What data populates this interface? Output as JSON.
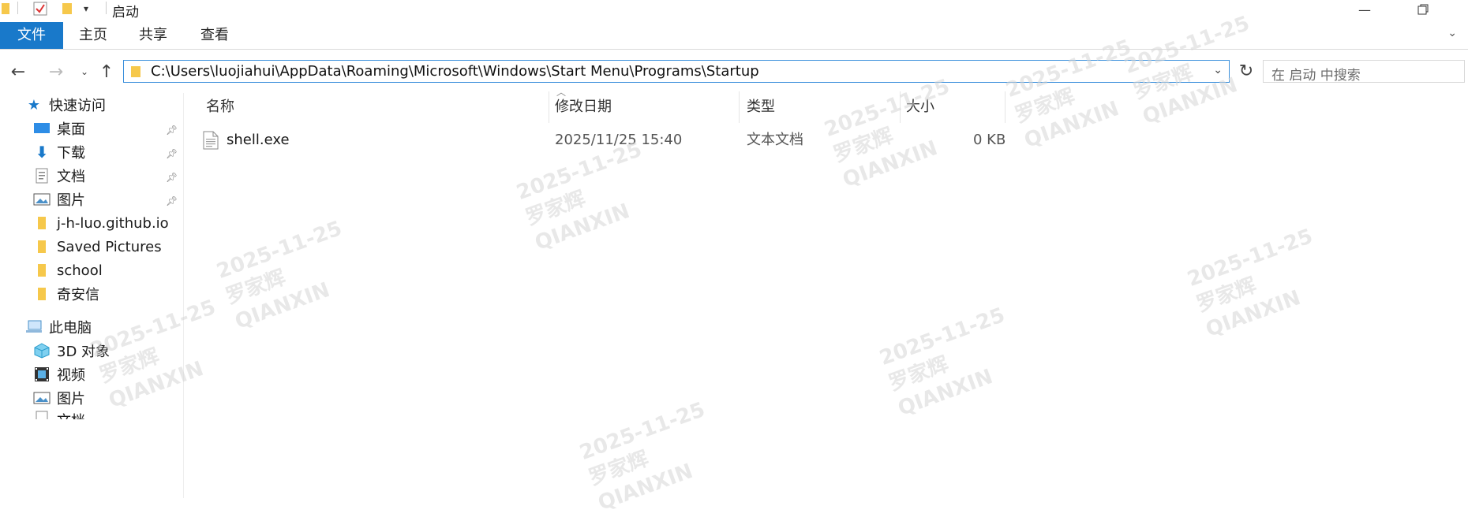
{
  "window": {
    "title": "启动",
    "restore_icon": "restore-icon",
    "minimize_icon": "minimize-icon"
  },
  "ribbon": {
    "file_tab": "文件",
    "tabs": [
      "主页",
      "共享",
      "查看"
    ]
  },
  "address_bar": {
    "path": "C:\\Users\\luojiahui\\AppData\\Roaming\\Microsoft\\Windows\\Start Menu\\Programs\\Startup",
    "search_placeholder": "在 启动 中搜索"
  },
  "sidebar": {
    "quick_access": "快速访问",
    "items": [
      {
        "label": "桌面",
        "icon": "desktop-icon",
        "pinned": true
      },
      {
        "label": "下载",
        "icon": "download-icon",
        "pinned": true
      },
      {
        "label": "文档",
        "icon": "document-icon",
        "pinned": true
      },
      {
        "label": "图片",
        "icon": "pictures-icon",
        "pinned": true
      },
      {
        "label": "j-h-luo.github.io",
        "icon": "folder-icon",
        "pinned": false
      },
      {
        "label": "Saved Pictures",
        "icon": "folder-icon",
        "pinned": false
      },
      {
        "label": "school",
        "icon": "folder-icon",
        "pinned": false
      },
      {
        "label": "奇安信",
        "icon": "folder-icon",
        "pinned": false
      }
    ],
    "this_pc": "此电脑",
    "pc_items": [
      {
        "label": "3D 对象",
        "icon": "3d-objects-icon"
      },
      {
        "label": "视频",
        "icon": "video-icon"
      },
      {
        "label": "图片",
        "icon": "pictures-icon"
      },
      {
        "label": "文档",
        "icon": "document-icon"
      }
    ]
  },
  "columns": {
    "name": "名称",
    "modified": "修改日期",
    "type": "类型",
    "size": "大小"
  },
  "files": [
    {
      "name": "shell.exe",
      "modified": "2025/11/25 15:40",
      "type": "文本文档",
      "size": "0 KB",
      "icon": "text-file-icon"
    }
  ],
  "watermark": {
    "date": "2025-11-25",
    "name": "罗家辉",
    "org": "QIANXIN"
  },
  "colors": {
    "accent": "#1979ca",
    "address_border": "#3a8fdb",
    "folder": "#f6c84b"
  }
}
